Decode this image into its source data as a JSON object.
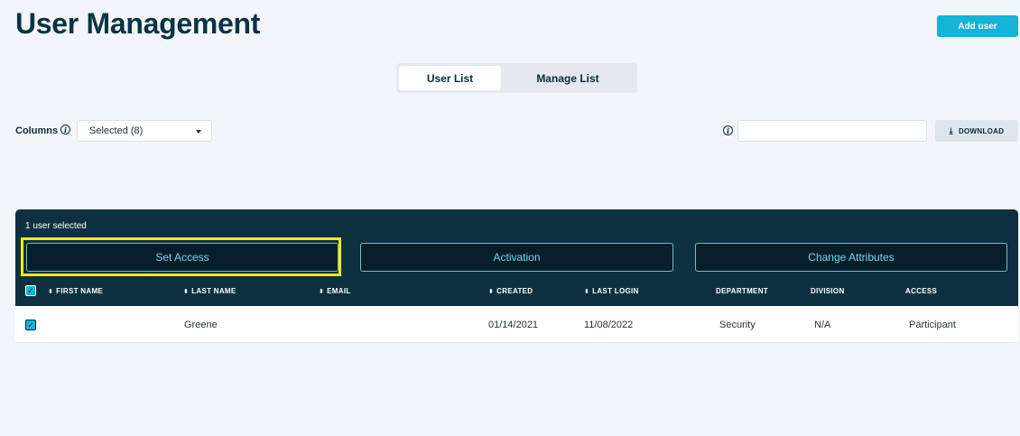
{
  "page": {
    "title": "User Management"
  },
  "header": {
    "add_user_label": "Add user"
  },
  "tabs": [
    {
      "label": "User List",
      "active": true
    },
    {
      "label": "Manage List",
      "active": false
    }
  ],
  "toolbar": {
    "columns_label": "Columns",
    "columns_selected": "Selected (8)",
    "search_value": "",
    "download_label": "DOWNLOAD"
  },
  "selection": {
    "status_text": "1 user selected",
    "actions": [
      "Set Access",
      "Activation",
      "Change Attributes"
    ],
    "highlighted_action": "Set Access"
  },
  "table": {
    "columns": [
      "FIRST NAME",
      "LAST NAME",
      "EMAIL",
      "CREATED",
      "LAST LOGIN",
      "DEPARTMENT",
      "DIVISION",
      "ACCESS"
    ],
    "rows": [
      {
        "selected": true,
        "first_name": "",
        "last_name": "Greene",
        "email": "",
        "created": "01/14/2021",
        "last_login": "11/08/2022",
        "department": "Security",
        "division": "N/A",
        "access": "Participant"
      }
    ]
  },
  "colors": {
    "accent": "#13b4d6",
    "panel": "#0d3141",
    "highlight": "#f4ec06",
    "action_text": "#7ad3ee"
  }
}
